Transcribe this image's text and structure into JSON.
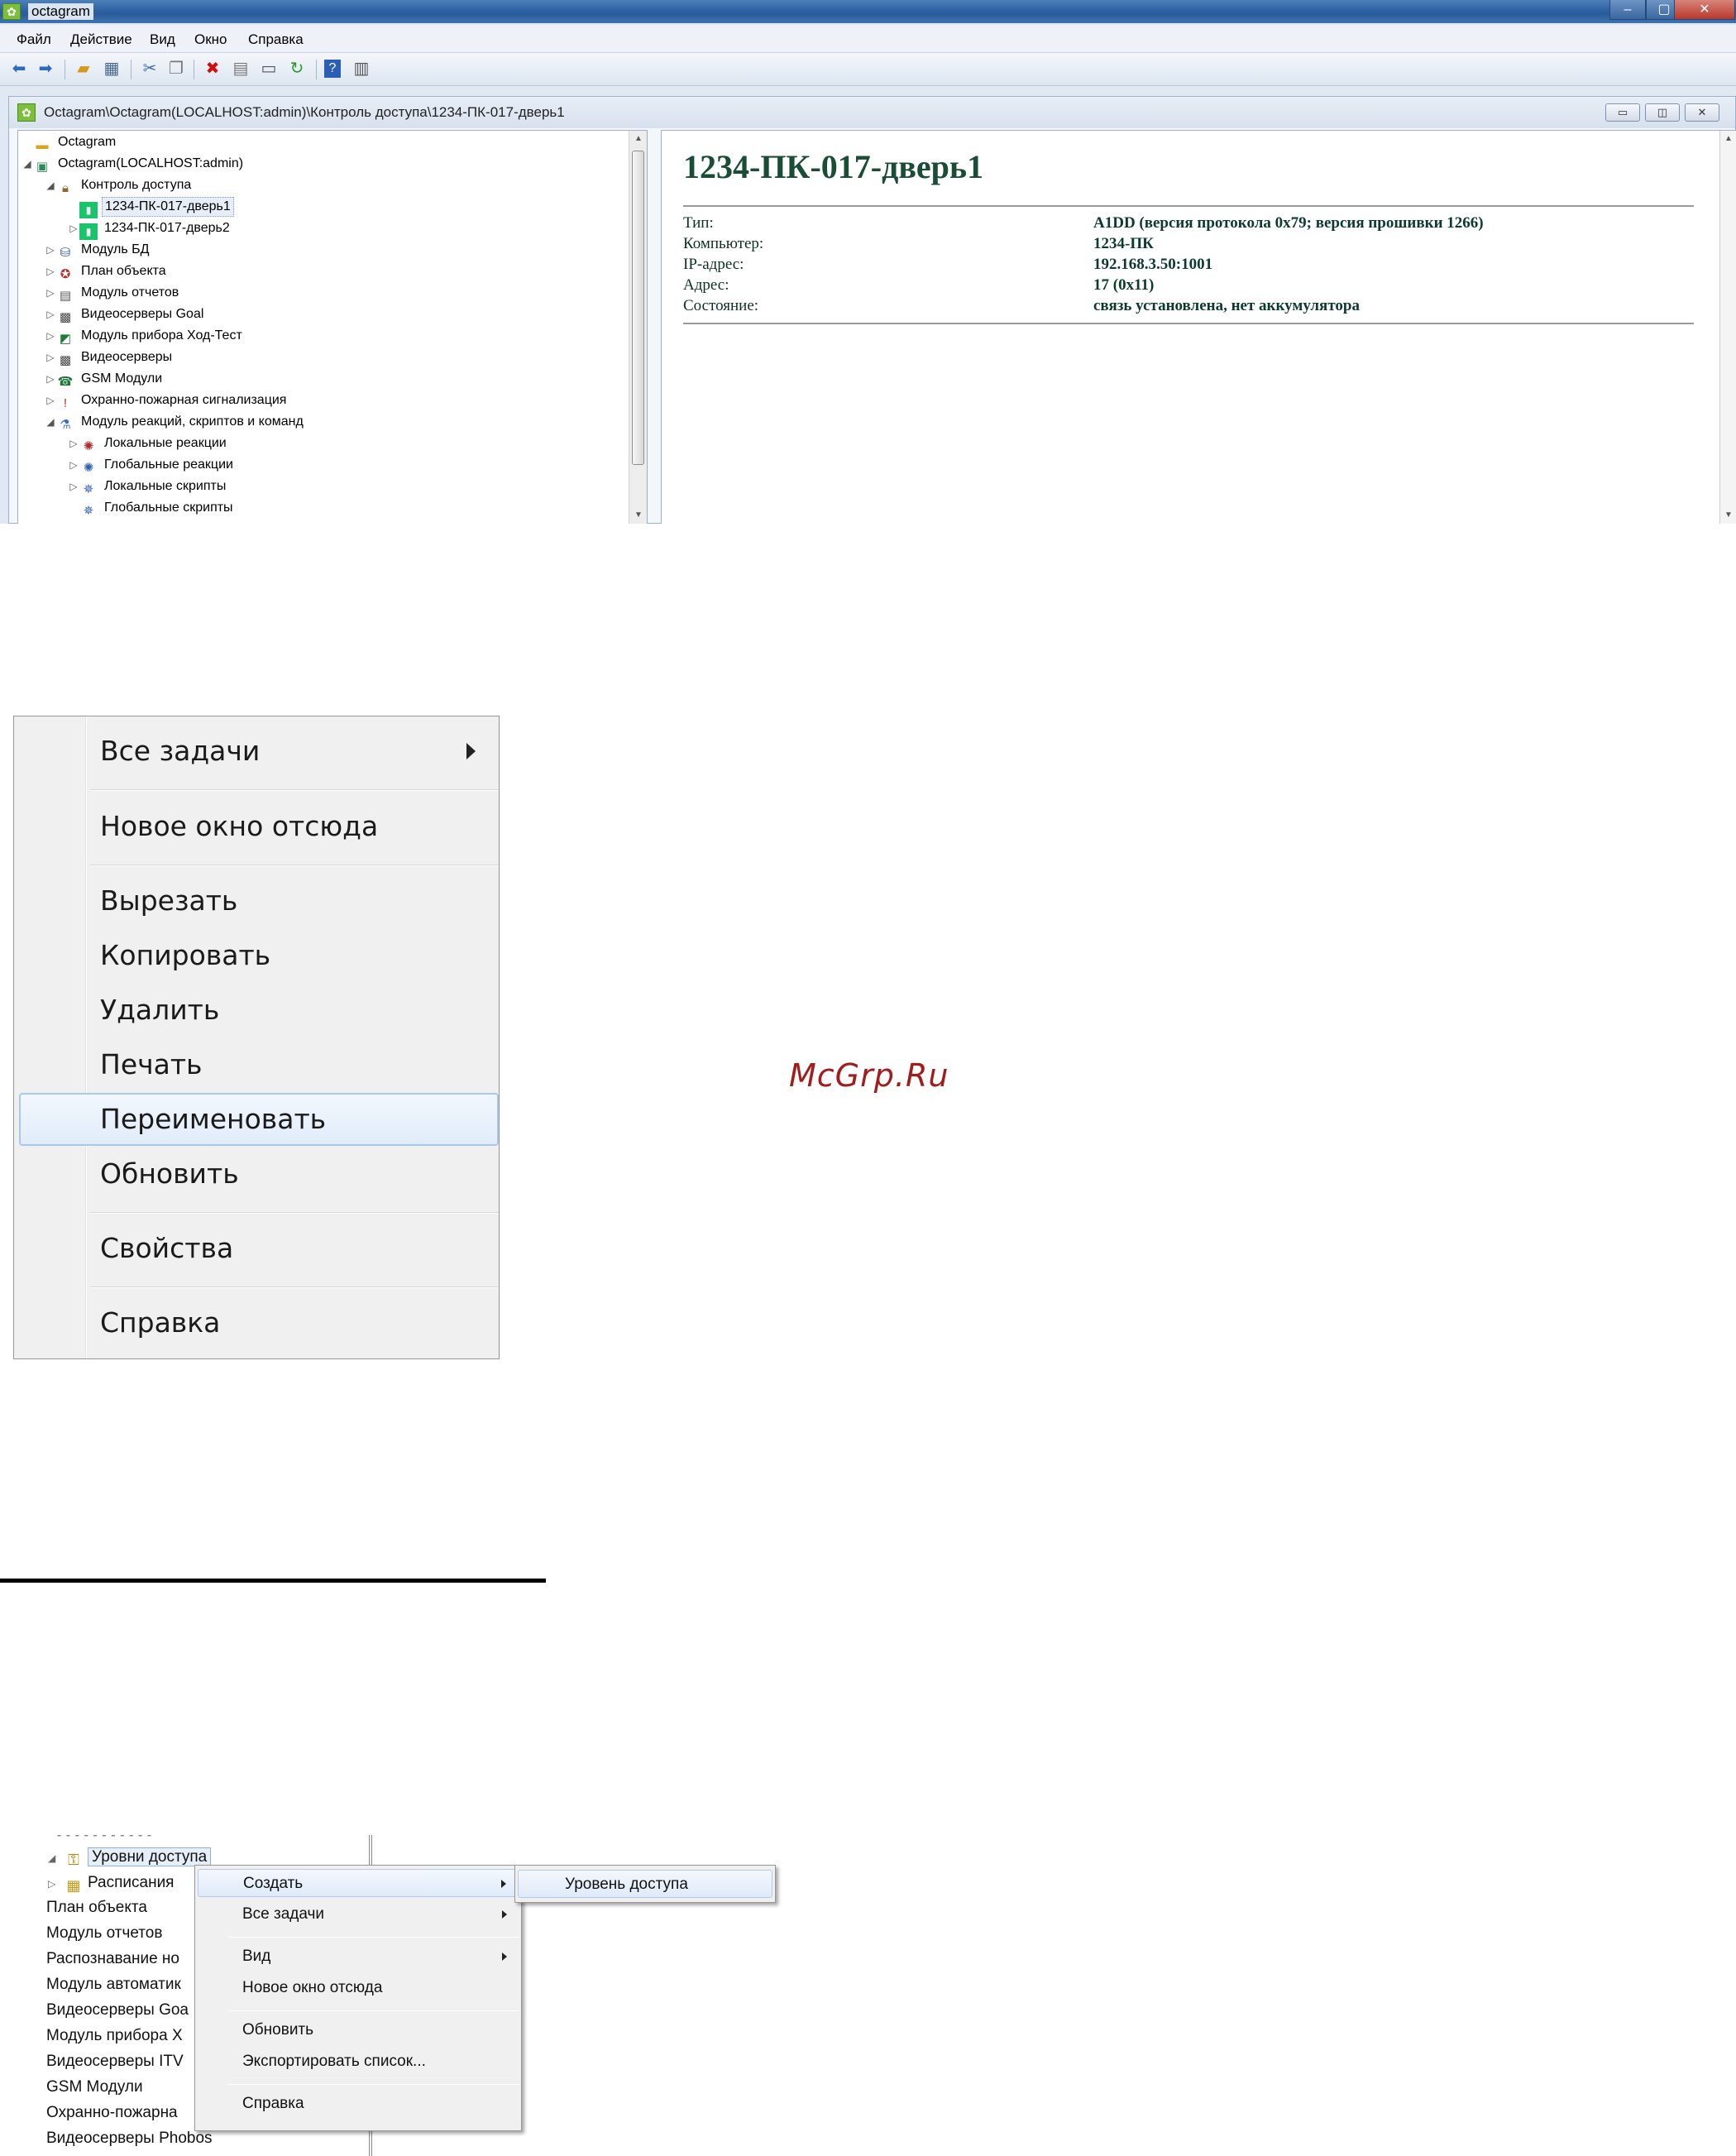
{
  "window": {
    "title": "octagram",
    "controls": {
      "minimize": "‒",
      "maximize": "▢",
      "close": "✕"
    }
  },
  "menubar": [
    "Файл",
    "Действие",
    "Вид",
    "Окно",
    "Справка"
  ],
  "toolbar_icons": [
    "back-icon",
    "forward-icon",
    "up-folder-icon",
    "show-hide-tree-icon",
    "cut-icon",
    "copy-icon",
    "delete-icon",
    "properties-icon",
    "print-icon",
    "refresh-icon",
    "help-icon",
    "action-pane-icon"
  ],
  "child_window": {
    "title": "Octagram\\Octagram(LOCALHOST:admin)\\Контроль доступа\\1234-ПК-017-дверь1"
  },
  "tree": [
    {
      "label": "Octagram",
      "icon": "folder-icon",
      "level": 0,
      "expand": ""
    },
    {
      "label": "Octagram(LOCALHOST:admin)",
      "icon": "octagram-icon",
      "level": 0,
      "expand": "open"
    },
    {
      "label": "Контроль доступа",
      "icon": "lock-icon",
      "level": 1,
      "expand": "open"
    },
    {
      "label": "1234-ПК-017-дверь1",
      "icon": "door-icon",
      "level": 2,
      "expand": "",
      "selected": true
    },
    {
      "label": "1234-ПК-017-дверь2",
      "icon": "door-icon",
      "level": 2,
      "expand": "closed"
    },
    {
      "label": "Модуль БД",
      "icon": "database-icon",
      "level": 1,
      "expand": "closed"
    },
    {
      "label": "План объекта",
      "icon": "plan-icon",
      "level": 1,
      "expand": "closed"
    },
    {
      "label": "Модуль отчетов",
      "icon": "report-icon",
      "level": 1,
      "expand": "closed"
    },
    {
      "label": "Видеосерверы Goal",
      "icon": "camera-icon",
      "level": 1,
      "expand": "closed"
    },
    {
      "label": "Модуль прибора Ход-Тест",
      "icon": "device-icon",
      "level": 1,
      "expand": "closed"
    },
    {
      "label": "Видеосерверы",
      "icon": "camera-icon",
      "level": 1,
      "expand": "closed"
    },
    {
      "label": "GSM Модули",
      "icon": "phone-icon",
      "level": 1,
      "expand": "closed"
    },
    {
      "label": "Охранно-пожарная сигнализация",
      "icon": "fire-alarm-icon",
      "level": 1,
      "expand": "closed"
    },
    {
      "label": "Модуль реакций, скриптов и команд",
      "icon": "flask-icon",
      "level": 1,
      "expand": "open"
    },
    {
      "label": "Локальные реакции",
      "icon": "reaction-icon",
      "level": 2,
      "expand": "closed"
    },
    {
      "label": "Глобальные реакции",
      "icon": "reaction-icon",
      "level": 2,
      "expand": "closed"
    },
    {
      "label": "Локальные скрипты",
      "icon": "script-icon",
      "level": 2,
      "expand": "closed"
    },
    {
      "label": "Глобальные скрипты",
      "icon": "script-icon",
      "level": 2,
      "expand": ""
    }
  ],
  "detail": {
    "title": "1234-ПК-017-дверь1",
    "rows": [
      {
        "label": "Тип:",
        "value": "A1DD (версия протокола 0x79; версия прошивки 1266)"
      },
      {
        "label": "Компьютер:",
        "value": "1234-ПК"
      },
      {
        "label": "IP-адрес:",
        "value": "192.168.3.50:1001"
      },
      {
        "label": "Адрес:",
        "value": "17 (0x11)"
      },
      {
        "label": "Состояние:",
        "value": "связь установлена, нет аккумулятора"
      }
    ]
  },
  "context_menu_large": {
    "items": [
      {
        "label": "Все задачи",
        "submenu": true
      },
      {
        "separator": true
      },
      {
        "label": "Новое окно отсюда"
      },
      {
        "separator": true
      },
      {
        "label": "Вырезать"
      },
      {
        "label": "Копировать"
      },
      {
        "label": "Удалить"
      },
      {
        "label": "Печать"
      },
      {
        "label": "Переименовать",
        "highlighted": true
      },
      {
        "label": "Обновить"
      },
      {
        "separator": true
      },
      {
        "label": "Свойства"
      },
      {
        "separator": true
      },
      {
        "label": "Справка"
      }
    ]
  },
  "watermark": "McGrp.Ru",
  "tree_small": [
    {
      "label": "Уровни доступа",
      "icon": "access-levels-icon",
      "expand": "open",
      "selected": true,
      "indent": 1
    },
    {
      "label": "Расписания",
      "icon": "schedule-icon",
      "expand": "closed",
      "indent": 1
    },
    {
      "label": "План объекта",
      "indent": 0
    },
    {
      "label": "Модуль отчетов",
      "indent": 0
    },
    {
      "label": "Распознавание но",
      "indent": 0
    },
    {
      "label": "Модуль автоматик",
      "indent": 0
    },
    {
      "label": "Видеосерверы Goa",
      "indent": 0
    },
    {
      "label": "Модуль прибора Х",
      "indent": 0
    },
    {
      "label": "Видеосерверы ITV",
      "indent": 0
    },
    {
      "label": "GSM Модули",
      "indent": 0
    },
    {
      "label": "Охранно-пожарна",
      "indent": 0
    },
    {
      "label": "Видеосерверы Phobos",
      "indent": 0
    }
  ],
  "context_menu_small": {
    "items": [
      {
        "label": "Создать",
        "submenu": true,
        "highlighted": true
      },
      {
        "label": "Все задачи",
        "submenu": true
      },
      {
        "separator": true
      },
      {
        "label": "Вид",
        "submenu": true
      },
      {
        "label": "Новое окно отсюда"
      },
      {
        "separator": true
      },
      {
        "label": "Обновить"
      },
      {
        "label": "Экспортировать список..."
      },
      {
        "separator": true
      },
      {
        "label": "Справка"
      }
    ],
    "submenu": {
      "label": "Уровень доступа"
    }
  }
}
